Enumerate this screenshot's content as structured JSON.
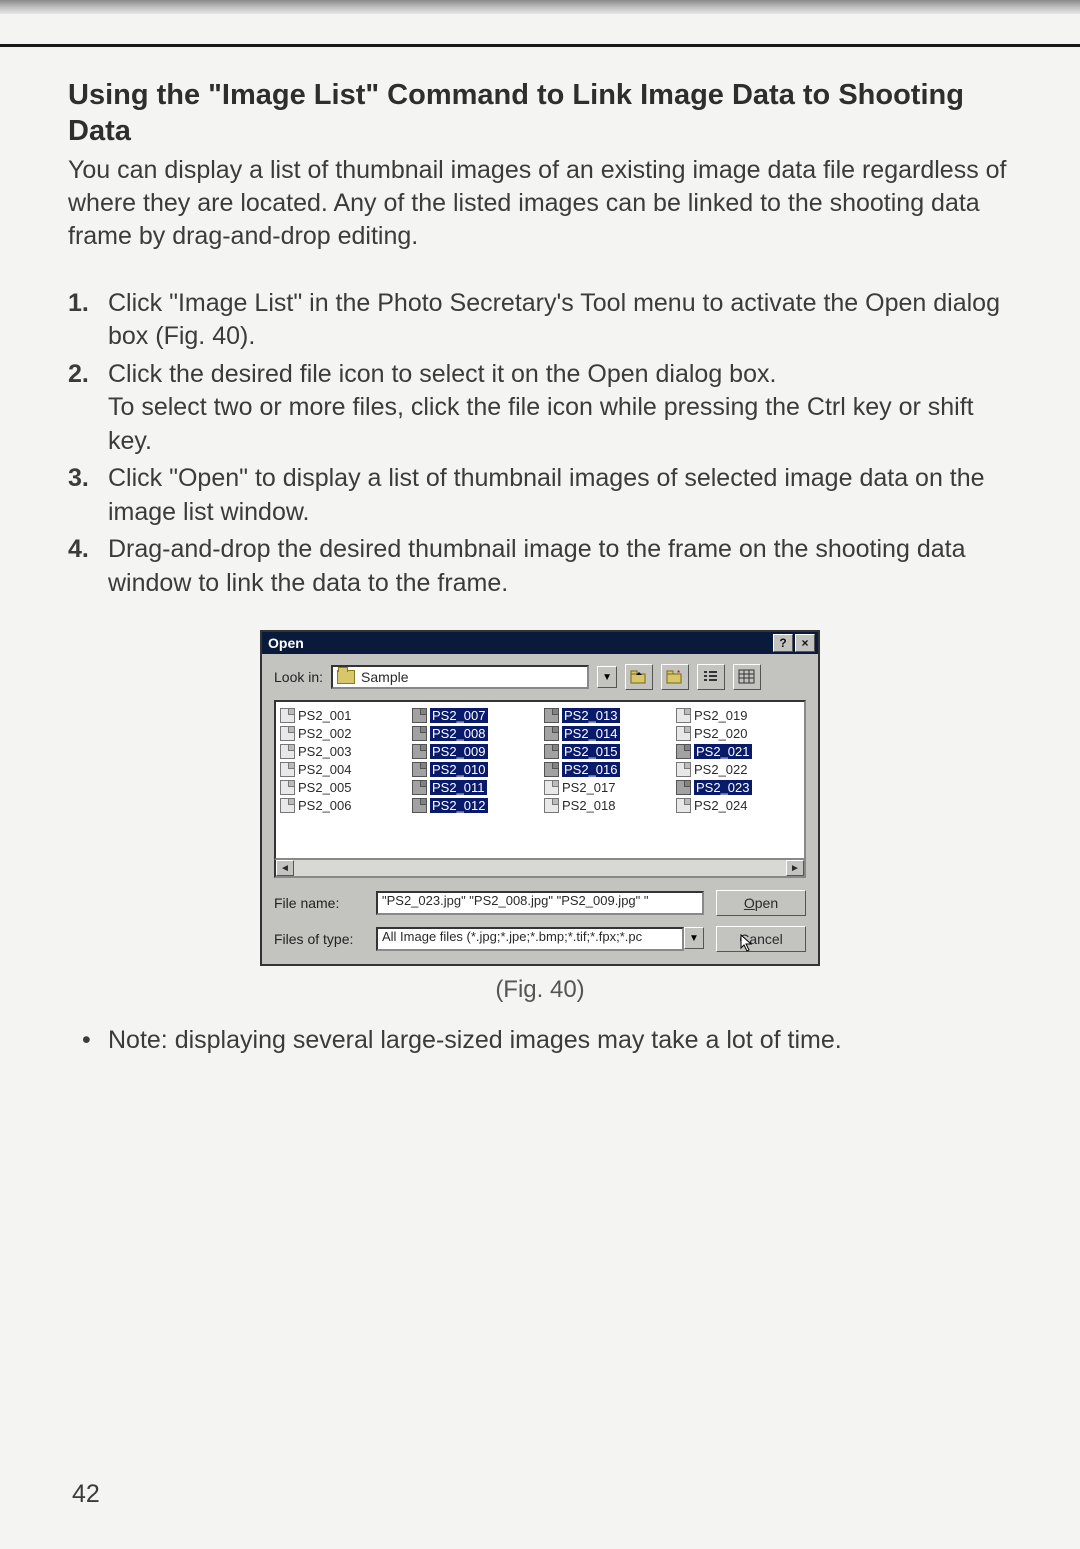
{
  "page": {
    "number": "42",
    "heading": "Using the \"Image List\" Command to Link Image Data to Shooting Data",
    "intro": "You can display a list of thumbnail images of an existing image data file regardless of where they are located. Any of the listed images can be linked to the shooting data frame by drag-and-drop editing.",
    "steps": [
      "Click \"Image List\" in the Photo Secretary's Tool menu to activate the Open dialog box (Fig. 40).",
      "Click the desired file icon to select it on the Open dialog box.\nTo select two or more files, click the file icon while pressing the Ctrl key or shift key.",
      "Click \"Open\" to display a list of thumbnail images of selected image data on the image list window.",
      "Drag-and-drop the desired thumbnail image to the frame on the shooting data window to link the data to the frame."
    ],
    "figure_caption": "(Fig. 40)",
    "note": "Note: displaying several large-sized images may take a lot of time."
  },
  "dialog": {
    "title": "Open",
    "lookin_label": "Look in:",
    "lookin_value": "Sample",
    "filename_label": "File name:",
    "filename_value": "\"PS2_023.jpg\" \"PS2_008.jpg\" \"PS2_009.jpg\" \"",
    "filetype_label": "Files of type:",
    "filetype_value": "All Image files (*.jpg;*.jpe;*.bmp;*.tif;*.fpx;*.pc",
    "open_button": "Open",
    "cancel_button": "Cancel",
    "files": [
      {
        "name": "PS2_001",
        "sel": false
      },
      {
        "name": "PS2_002",
        "sel": false
      },
      {
        "name": "PS2_003",
        "sel": false
      },
      {
        "name": "PS2_004",
        "sel": false
      },
      {
        "name": "PS2_005",
        "sel": false
      },
      {
        "name": "PS2_006",
        "sel": false
      },
      {
        "name": "PS2_007",
        "sel": true
      },
      {
        "name": "PS2_008",
        "sel": true
      },
      {
        "name": "PS2_009",
        "sel": true
      },
      {
        "name": "PS2_010",
        "sel": true
      },
      {
        "name": "PS2_011",
        "sel": true
      },
      {
        "name": "PS2_012",
        "sel": true
      },
      {
        "name": "PS2_013",
        "sel": true
      },
      {
        "name": "PS2_014",
        "sel": true
      },
      {
        "name": "PS2_015",
        "sel": true
      },
      {
        "name": "PS2_016",
        "sel": true
      },
      {
        "name": "PS2_017",
        "sel": false
      },
      {
        "name": "PS2_018",
        "sel": false
      },
      {
        "name": "PS2_019",
        "sel": false
      },
      {
        "name": "PS2_020",
        "sel": false
      },
      {
        "name": "PS2_021",
        "sel": true
      },
      {
        "name": "PS2_022",
        "sel": false
      },
      {
        "name": "PS2_023",
        "sel": true
      },
      {
        "name": "PS2_024",
        "sel": false
      }
    ]
  }
}
